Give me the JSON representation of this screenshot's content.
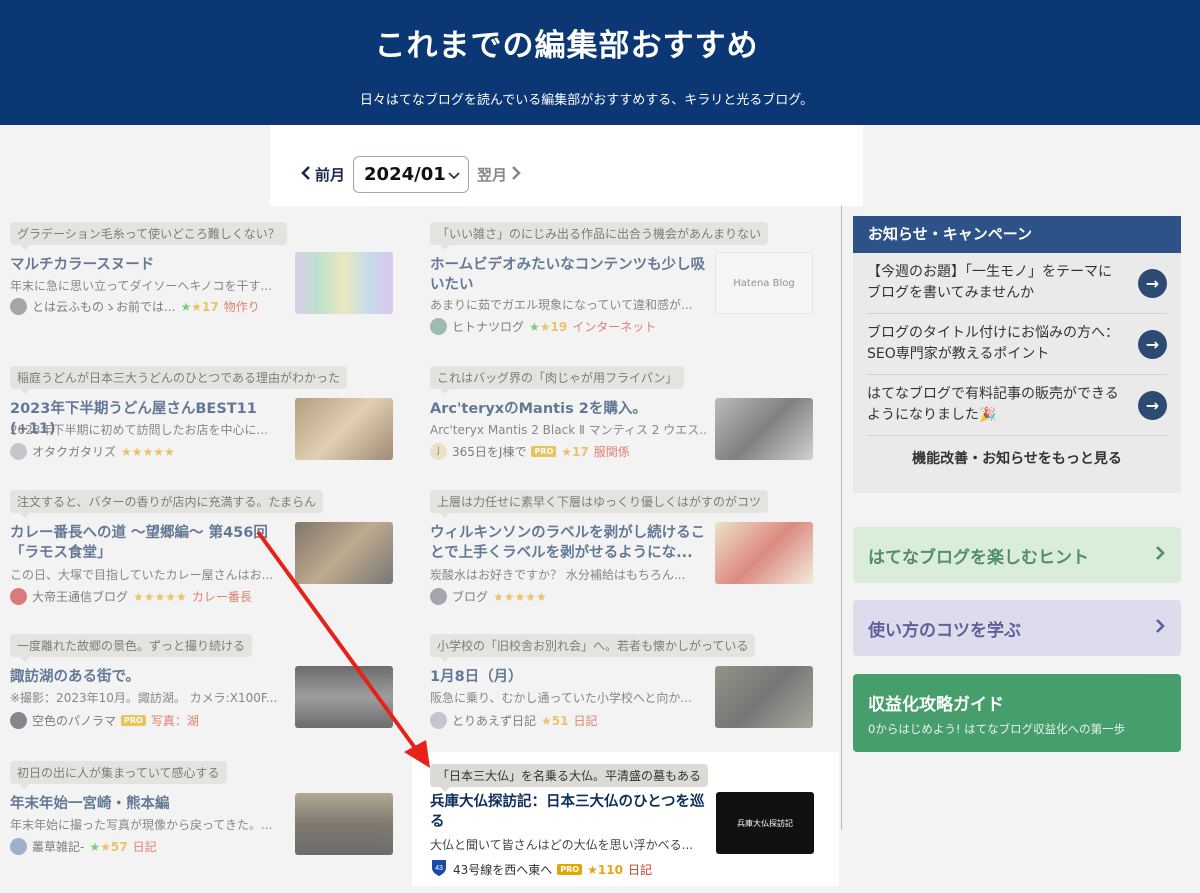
{
  "hero": {
    "title": "これまでの編集部おすすめ",
    "subtitle": "日々はてなブログを読んでいる編集部がおすすめする、キラリと光るブログ。",
    "prev_label": "前月",
    "next_label": "翌月",
    "month_value": "2024/01"
  },
  "entries": [
    {
      "tag": "グラデーション毛糸って使いどころ難しくない？",
      "title": "マルチカラースヌード",
      "desc": "年末に急に思い立ってダイソーへキノコを干す...",
      "author": "とは云ふものゝお前では...",
      "stars": "17",
      "category": "物作り"
    },
    {
      "tag": "「いい雑さ」のにじみ出る作品に出合う機会があんまりない",
      "title": "ホームビデオみたいなコンテンツも少し吸いたい",
      "desc": "あまりに茹でガエル現象になっていて違和感が...",
      "author": "ヒトナツログ",
      "stars": "19",
      "category": "インターネット"
    },
    {
      "tag": "稲庭うどんが日本三大うどんのひとつである理由がわかった",
      "title": "2023年下半期うどん屋さんBEST11 (+11)",
      "desc": "2023年下半期に初めて訪問したお店を中心に...",
      "author": "オタクガタリズ",
      "stars": "★★★★★",
      "category": ""
    },
    {
      "tag": "これはバッグ界の「肉じゃが用フライパン」",
      "title": "Arc'teryxのMantis 2を購入。",
      "desc": "Arc'teryx Mantis 2 Black Ⅱ マンティス 2 ウエス...",
      "author": "365日をJ棟で",
      "stars": "17",
      "category": "服関係"
    },
    {
      "tag": "注文すると、バターの香りが店内に充満する。たまらん",
      "title": "カレー番長への道 ～望郷編～ 第456回「ラモス食堂」",
      "desc": "この日、大塚で目指していたカレー屋さんはお...",
      "author": "大帝王通信ブログ",
      "stars": "★★★★★",
      "category": "カレー番長"
    },
    {
      "tag": "上層は力任せに素早く下層はゆっくり優しくはがすのがコツ",
      "title": "ウィルキンソンのラベルを剥がし続けることで上手くラベルを剥がせるようにな...",
      "desc": "炭酸水はお好きですか？ 水分補給はもちろん...",
      "author": "ブログ",
      "stars": "★★★★★",
      "category": ""
    },
    {
      "tag": "一度離れた故郷の景色。ずっと撮り続ける",
      "title": "諏訪湖のある街で。",
      "desc": "※撮影：2023年10月。諏訪湖。 カメラ:X100F...",
      "author": "空色のパノラマ",
      "stars": "",
      "category": "写真：湖"
    },
    {
      "tag": "小学校の「旧校舎お別れ会」へ。若者も懐かしがっている",
      "title": "1月8日（月）",
      "desc": "阪急に乗り、むかし通っていた小学校へと向か...",
      "author": "とりあえず日記",
      "stars": "51",
      "category": "日記"
    },
    {
      "tag": "初日の出に人が集まっていて感心する",
      "title": "年末年始一宮崎・熊本編",
      "desc": "年末年始に撮った写真が現像から戻ってきた。...",
      "author": "叢草雑記-",
      "stars": "57",
      "category": "日記"
    },
    {
      "tag": "「日本三大仏」を名乗る大仏。平清盛の墓もある",
      "title": "兵庫大仏探訪記：日本三大仏のひとつを巡る",
      "desc": "大仏と聞いて皆さんはどの大仏を思い浮かべる...",
      "author": "43号線を西へ東へ",
      "stars": "110",
      "category": "日記"
    }
  ],
  "sidebar": {
    "news_title": "お知らせ・キャンペーン",
    "news": [
      "【今週のお題】「一生モノ」をテーマにブログを書いてみませんか",
      "ブログのタイトル付けにお悩みの方へ：SEO専門家が教えるポイント",
      "はてなブログで有料記事の販売ができるようになりました🎉"
    ],
    "more_label": "機能改善・お知らせをもっと見る",
    "hint_label": "はてなブログを楽しむヒント",
    "tips_label": "使い方のコツを学ぶ",
    "income_label": "収益化攻略ガイド",
    "income_sub": "0からはじめよう! はてなブログ収益化への第一歩"
  },
  "thumb_label": "兵庫大仏探訪記",
  "hatena_label": "Hatena Blog",
  "pro_label": "PRO",
  "route_label": "43"
}
